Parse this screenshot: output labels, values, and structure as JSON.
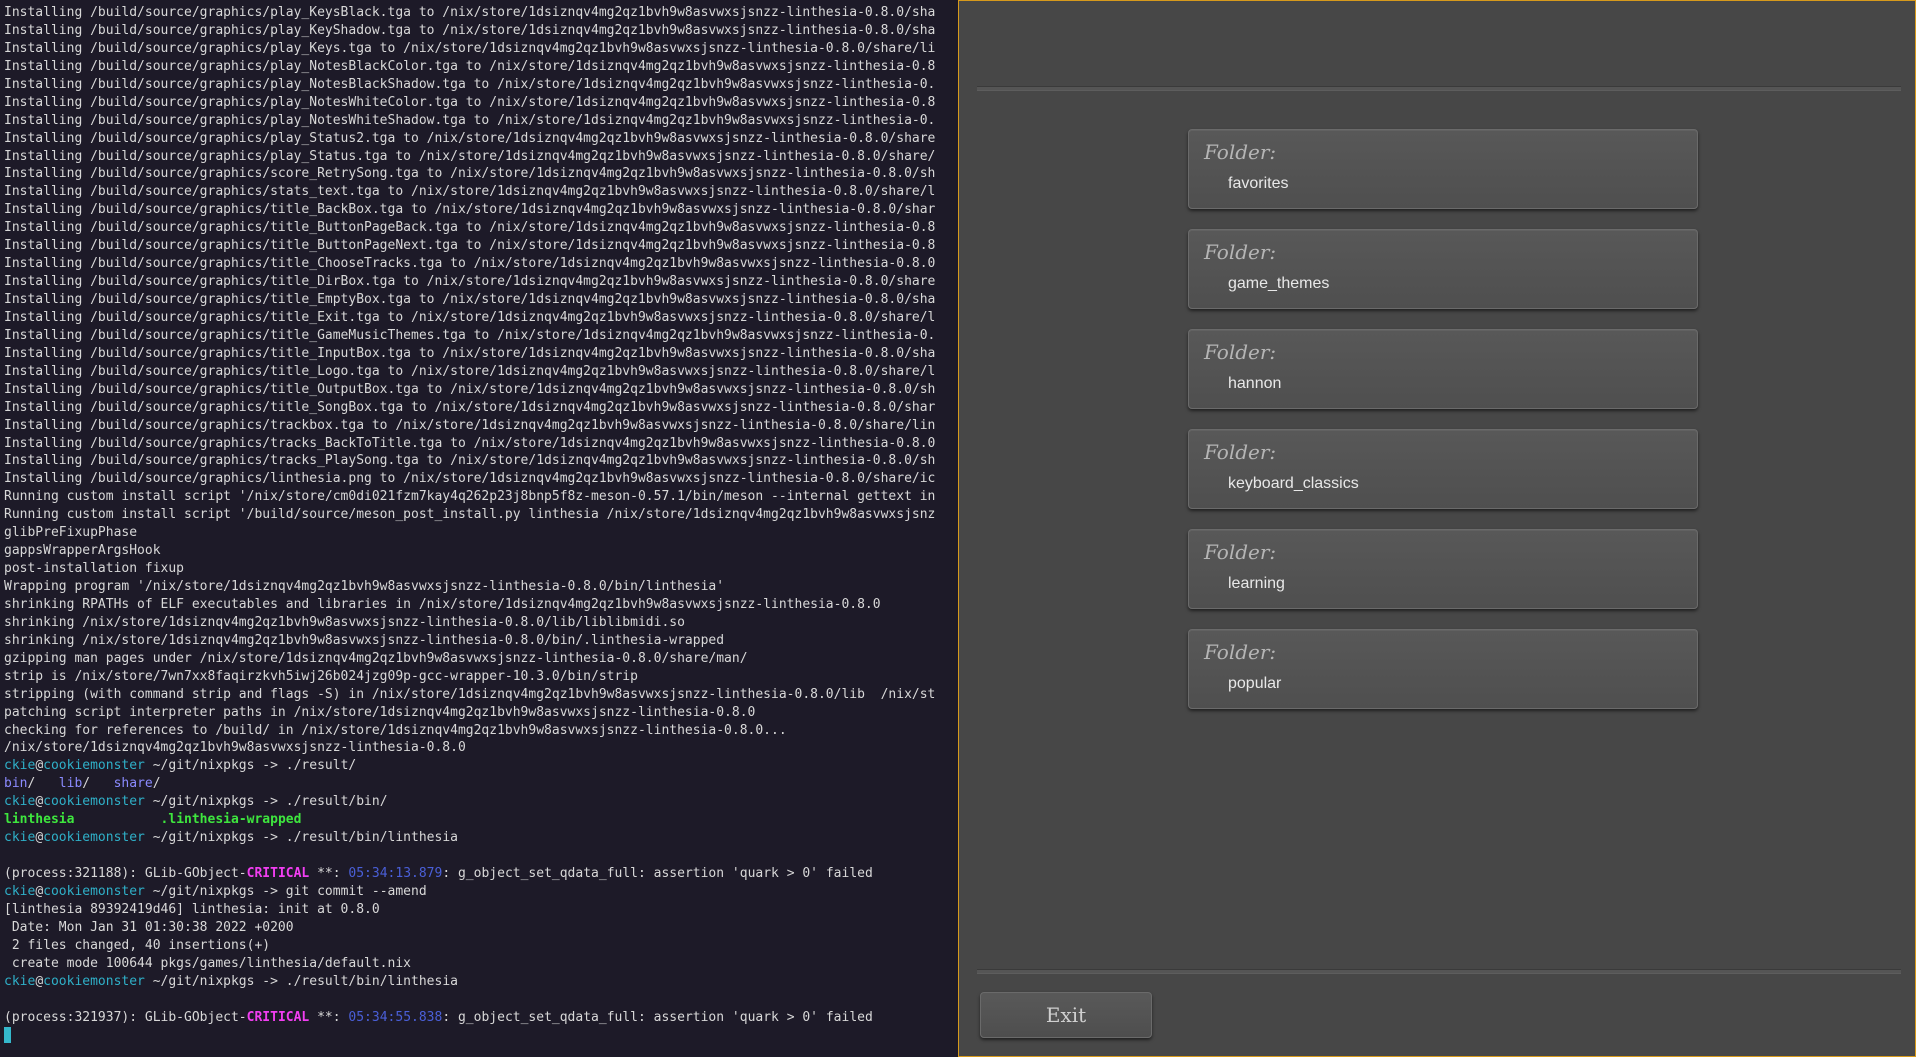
{
  "terminal": {
    "lines": [
      "Installing /build/source/graphics/play_KeysBlack.tga to /nix/store/1dsiznqv4mg2qz1bvh9w8asvwxsjsnzz-linthesia-0.8.0/sha",
      "Installing /build/source/graphics/play_KeyShadow.tga to /nix/store/1dsiznqv4mg2qz1bvh9w8asvwxsjsnzz-linthesia-0.8.0/sha",
      "Installing /build/source/graphics/play_Keys.tga to /nix/store/1dsiznqv4mg2qz1bvh9w8asvwxsjsnzz-linthesia-0.8.0/share/li",
      "Installing /build/source/graphics/play_NotesBlackColor.tga to /nix/store/1dsiznqv4mg2qz1bvh9w8asvwxsjsnzz-linthesia-0.8",
      "Installing /build/source/graphics/play_NotesBlackShadow.tga to /nix/store/1dsiznqv4mg2qz1bvh9w8asvwxsjsnzz-linthesia-0.",
      "Installing /build/source/graphics/play_NotesWhiteColor.tga to /nix/store/1dsiznqv4mg2qz1bvh9w8asvwxsjsnzz-linthesia-0.8",
      "Installing /build/source/graphics/play_NotesWhiteShadow.tga to /nix/store/1dsiznqv4mg2qz1bvh9w8asvwxsjsnzz-linthesia-0.",
      "Installing /build/source/graphics/play_Status2.tga to /nix/store/1dsiznqv4mg2qz1bvh9w8asvwxsjsnzz-linthesia-0.8.0/share",
      "Installing /build/source/graphics/play_Status.tga to /nix/store/1dsiznqv4mg2qz1bvh9w8asvwxsjsnzz-linthesia-0.8.0/share/",
      "Installing /build/source/graphics/score_RetrySong.tga to /nix/store/1dsiznqv4mg2qz1bvh9w8asvwxsjsnzz-linthesia-0.8.0/sh",
      "Installing /build/source/graphics/stats_text.tga to /nix/store/1dsiznqv4mg2qz1bvh9w8asvwxsjsnzz-linthesia-0.8.0/share/l",
      "Installing /build/source/graphics/title_BackBox.tga to /nix/store/1dsiznqv4mg2qz1bvh9w8asvwxsjsnzz-linthesia-0.8.0/shar",
      "Installing /build/source/graphics/title_ButtonPageBack.tga to /nix/store/1dsiznqv4mg2qz1bvh9w8asvwxsjsnzz-linthesia-0.8",
      "Installing /build/source/graphics/title_ButtonPageNext.tga to /nix/store/1dsiznqv4mg2qz1bvh9w8asvwxsjsnzz-linthesia-0.8",
      "Installing /build/source/graphics/title_ChooseTracks.tga to /nix/store/1dsiznqv4mg2qz1bvh9w8asvwxsjsnzz-linthesia-0.8.0",
      "Installing /build/source/graphics/title_DirBox.tga to /nix/store/1dsiznqv4mg2qz1bvh9w8asvwxsjsnzz-linthesia-0.8.0/share",
      "Installing /build/source/graphics/title_EmptyBox.tga to /nix/store/1dsiznqv4mg2qz1bvh9w8asvwxsjsnzz-linthesia-0.8.0/sha",
      "Installing /build/source/graphics/title_Exit.tga to /nix/store/1dsiznqv4mg2qz1bvh9w8asvwxsjsnzz-linthesia-0.8.0/share/l",
      "Installing /build/source/graphics/title_GameMusicThemes.tga to /nix/store/1dsiznqv4mg2qz1bvh9w8asvwxsjsnzz-linthesia-0.",
      "Installing /build/source/graphics/title_InputBox.tga to /nix/store/1dsiznqv4mg2qz1bvh9w8asvwxsjsnzz-linthesia-0.8.0/sha",
      "Installing /build/source/graphics/title_Logo.tga to /nix/store/1dsiznqv4mg2qz1bvh9w8asvwxsjsnzz-linthesia-0.8.0/share/l",
      "Installing /build/source/graphics/title_OutputBox.tga to /nix/store/1dsiznqv4mg2qz1bvh9w8asvwxsjsnzz-linthesia-0.8.0/sh",
      "Installing /build/source/graphics/title_SongBox.tga to /nix/store/1dsiznqv4mg2qz1bvh9w8asvwxsjsnzz-linthesia-0.8.0/shar",
      "Installing /build/source/graphics/trackbox.tga to /nix/store/1dsiznqv4mg2qz1bvh9w8asvwxsjsnzz-linthesia-0.8.0/share/lin",
      "Installing /build/source/graphics/tracks_BackToTitle.tga to /nix/store/1dsiznqv4mg2qz1bvh9w8asvwxsjsnzz-linthesia-0.8.0",
      "Installing /build/source/graphics/tracks_PlaySong.tga to /nix/store/1dsiznqv4mg2qz1bvh9w8asvwxsjsnzz-linthesia-0.8.0/sh",
      "Installing /build/source/graphics/linthesia.png to /nix/store/1dsiznqv4mg2qz1bvh9w8asvwxsjsnzz-linthesia-0.8.0/share/ic",
      "Running custom install script '/nix/store/cm0di021fzm7kay4q262p23j8bnp5f8z-meson-0.57.1/bin/meson --internal gettext in",
      "Running custom install script '/build/source/meson_post_install.py linthesia /nix/store/1dsiznqv4mg2qz1bvh9w8asvwxsjsnz",
      "glibPreFixupPhase",
      "gappsWrapperArgsHook",
      "post-installation fixup",
      "Wrapping program '/nix/store/1dsiznqv4mg2qz1bvh9w8asvwxsjsnzz-linthesia-0.8.0/bin/linthesia'",
      "shrinking RPATHs of ELF executables and libraries in /nix/store/1dsiznqv4mg2qz1bvh9w8asvwxsjsnzz-linthesia-0.8.0",
      "shrinking /nix/store/1dsiznqv4mg2qz1bvh9w8asvwxsjsnzz-linthesia-0.8.0/lib/liblibmidi.so",
      "shrinking /nix/store/1dsiznqv4mg2qz1bvh9w8asvwxsjsnzz-linthesia-0.8.0/bin/.linthesia-wrapped",
      "gzipping man pages under /nix/store/1dsiznqv4mg2qz1bvh9w8asvwxsjsnzz-linthesia-0.8.0/share/man/",
      "strip is /nix/store/7wn7xx8faqirzkvh5iwj26b024jzg09p-gcc-wrapper-10.3.0/bin/strip",
      "stripping (with command strip and flags -S) in /nix/store/1dsiznqv4mg2qz1bvh9w8asvwxsjsnzz-linthesia-0.8.0/lib  /nix/st",
      "patching script interpreter paths in /nix/store/1dsiznqv4mg2qz1bvh9w8asvwxsjsnzz-linthesia-0.8.0",
      "checking for references to /build/ in /nix/store/1dsiznqv4mg2qz1bvh9w8asvwxsjsnzz-linthesia-0.8.0...",
      "/nix/store/1dsiznqv4mg2qz1bvh9w8asvwxsjsnzz-linthesia-0.8.0"
    ],
    "prompt": {
      "user": "ckie",
      "at": "@",
      "host": "cookiemonster",
      "path": " ~/git/nixpkgs -> "
    },
    "cmd1": "./result/",
    "ls1": {
      "a": "bin",
      "sep1": "/   ",
      "b": "lib",
      "sep2": "/   ",
      "c": "share",
      "sep3": "/"
    },
    "cmd2": "./result/bin/",
    "ls2": {
      "a": "linthesia",
      "gap": "           ",
      "b": ".linthesia-wrapped"
    },
    "cmd3": "./result/bin/linthesia",
    "err1": {
      "pre": "(process:321188): GLib-GObject-",
      "level": "CRITICAL",
      "mid": " **: ",
      "time": "05:34:13.879",
      "post": ": g_object_set_qdata_full: assertion 'quark > 0' failed"
    },
    "cmd4": "git commit --amend",
    "commit_lines": [
      "[linthesia 89392419d46] linthesia: init at 0.8.0",
      " Date: Mon Jan 31 01:30:38 2022 +0200",
      " 2 files changed, 40 insertions(+)",
      " create mode 100644 pkgs/games/linthesia/default.nix"
    ],
    "cmd5": "./result/bin/linthesia",
    "err2": {
      "pre": "(process:321937): GLib-GObject-",
      "level": "CRITICAL",
      "mid": " **: ",
      "time": "05:34:55.838",
      "post": ": g_object_set_qdata_full: assertion 'quark > 0' failed"
    }
  },
  "app": {
    "folder_label": "Folder:",
    "folders": [
      "favorites",
      "game_themes",
      "hannon",
      "keyboard_classics",
      "learning",
      "popular"
    ],
    "exit_label": "Exit",
    "accent_color": "#d79a1c"
  }
}
